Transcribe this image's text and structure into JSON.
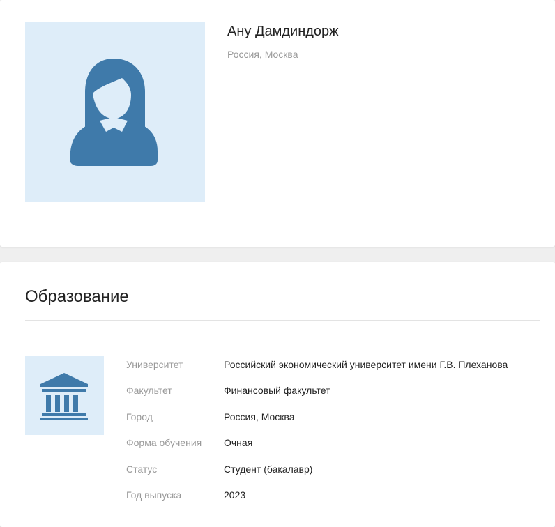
{
  "colors": {
    "accent": "#3f7aaa",
    "avatar_bg": "#deedf9",
    "label_gray": "#999999",
    "text_dark": "#222222"
  },
  "profile": {
    "name": "Ану Дамдиндорж",
    "location": "Россия, Москва",
    "avatar_icon": "female-user-icon"
  },
  "education": {
    "title": "Образование",
    "icon": "university-icon",
    "rows": [
      {
        "label": "Университет",
        "value": "Российский экономический университет имени Г.В. Плеханова"
      },
      {
        "label": "Факультет",
        "value": "Финансовый факультет"
      },
      {
        "label": "Город",
        "value": "Россия, Москва"
      },
      {
        "label": "Форма обучения",
        "value": "Очная"
      },
      {
        "label": "Статус",
        "value": "Студент (бакалавр)"
      },
      {
        "label": "Год выпуска",
        "value": "2023"
      }
    ]
  }
}
